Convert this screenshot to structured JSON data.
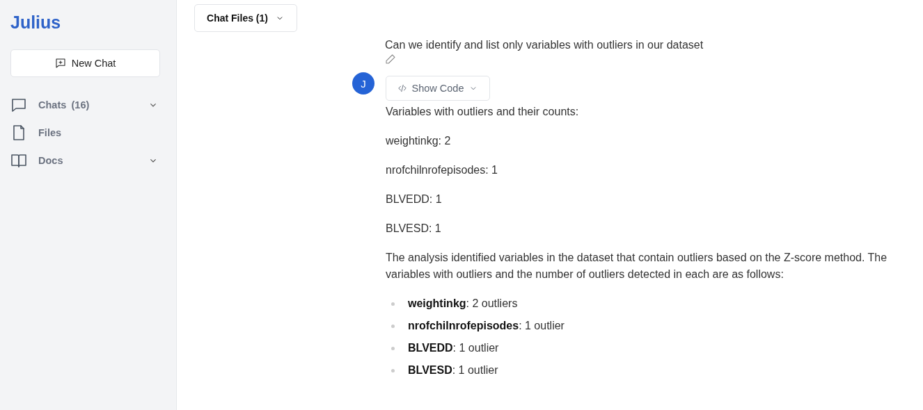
{
  "sidebar": {
    "logo": "Julius",
    "new_chat": "New Chat",
    "items": [
      {
        "kind": "chat",
        "label": "Chats",
        "count": "(16)",
        "expandable": true
      },
      {
        "kind": "file",
        "label": "Files",
        "expandable": false
      },
      {
        "kind": "book",
        "label": "Docs",
        "expandable": true
      }
    ]
  },
  "header": {
    "chat_files": "Chat Files (1)"
  },
  "user_message": "Can we identify and list only variables with outliers in our dataset",
  "assistant": {
    "avatar": "J",
    "show_code": "Show Code",
    "paragraphs": [
      "Variables with outliers and their counts:",
      "weightinkg: 2",
      "nrofchilnrofepisodes: 1",
      "BLVEDD: 1",
      "BLVESD: 1",
      "The analysis identified variables in the dataset that contain outliers based on the Z-score method. The variables with outliers and the number of outliers detected in each are as follows:"
    ],
    "bullets": [
      "**weightinkg**: 2 outliers",
      "**nrofchilnrofepisodes**: 1 outlier",
      "**BLVEDD**: 1 outlier",
      "**BLVESD**: 1 outlier"
    ]
  }
}
